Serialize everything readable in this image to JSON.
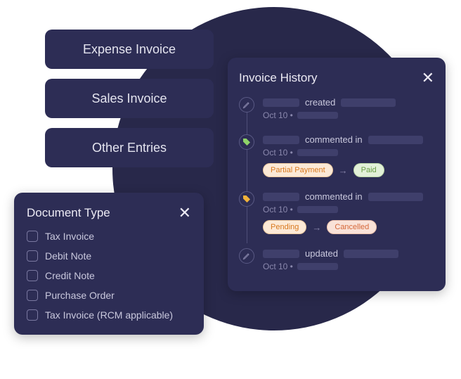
{
  "tabs": [
    {
      "label": "Expense Invoice"
    },
    {
      "label": "Sales Invoice"
    },
    {
      "label": "Other Entries"
    }
  ],
  "doctype": {
    "title": "Document Type",
    "items": [
      {
        "label": "Tax Invoice"
      },
      {
        "label": "Debit Note"
      },
      {
        "label": "Credit Note"
      },
      {
        "label": "Purchase Order"
      },
      {
        "label": "Tax Invoice (RCM applicable)"
      }
    ]
  },
  "history": {
    "title": "Invoice History",
    "events": [
      {
        "action": "created",
        "date": "Oct 10 •",
        "icon": "pencil"
      },
      {
        "action": "commented in",
        "date": "Oct 10 •",
        "icon": "tag-green",
        "chipA": "Partial Payment",
        "chipB": "Paid"
      },
      {
        "action": "commented in",
        "date": "Oct 10 •",
        "icon": "tag-orange",
        "chipA": "Pending",
        "chipB": "Cancelled"
      },
      {
        "action": "updated",
        "date": "Oct 10 •",
        "icon": "pencil"
      }
    ]
  }
}
